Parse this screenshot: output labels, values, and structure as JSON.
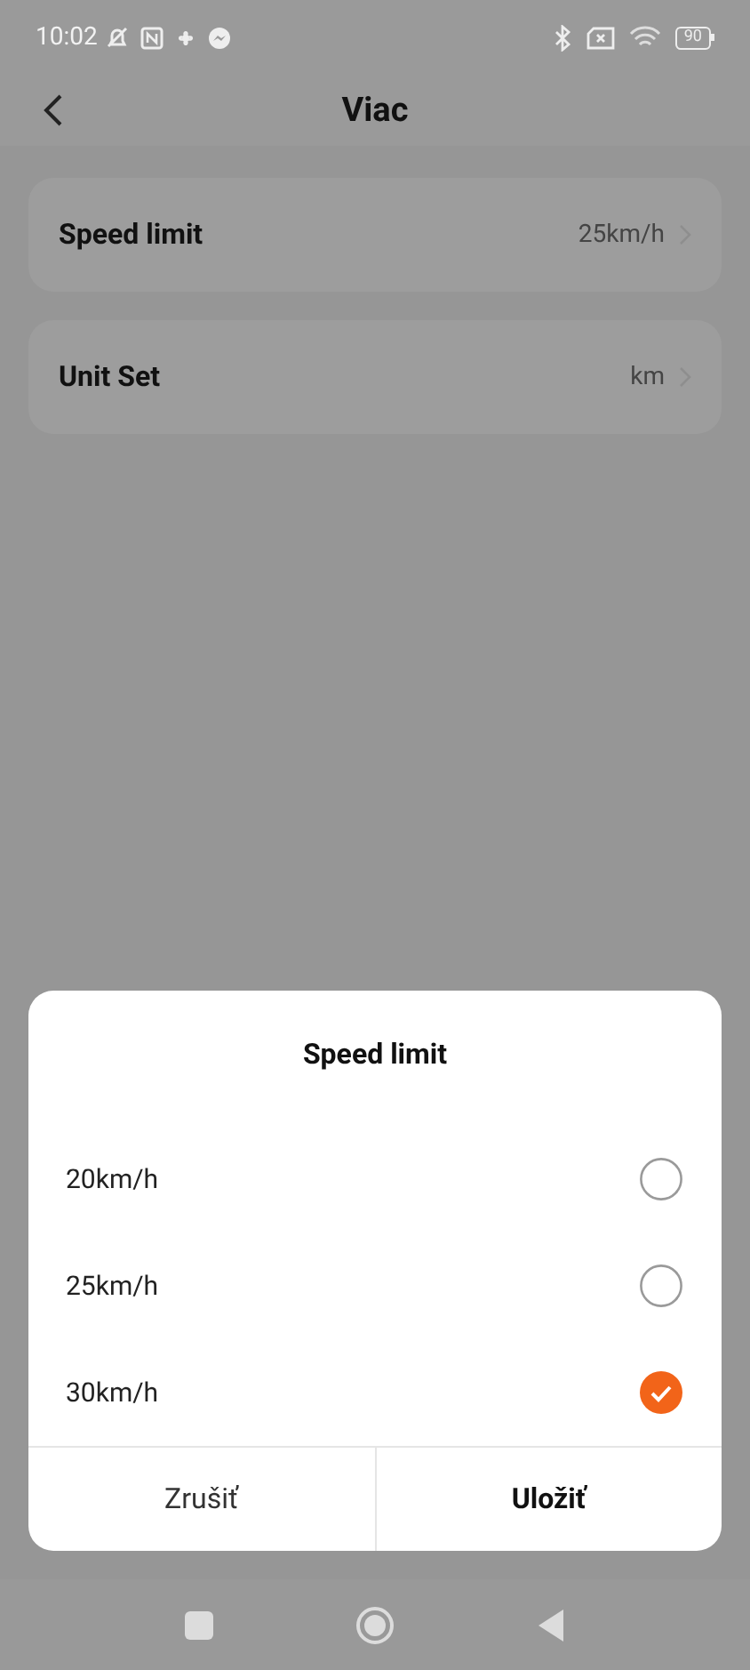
{
  "status_bar": {
    "time": "10:02",
    "battery": "90"
  },
  "header": {
    "title": "Viac"
  },
  "settings": [
    {
      "label": "Speed limit",
      "value": "25km/h"
    },
    {
      "label": "Unit Set",
      "value": "km"
    }
  ],
  "dialog": {
    "title": "Speed limit",
    "options": [
      {
        "label": "20km/h",
        "selected": false
      },
      {
        "label": "25km/h",
        "selected": false
      },
      {
        "label": "30km/h",
        "selected": true
      }
    ],
    "buttons": [
      {
        "label": "Zrušiť",
        "kind": "cancel"
      },
      {
        "label": "Uložiť",
        "kind": "confirm"
      }
    ]
  }
}
